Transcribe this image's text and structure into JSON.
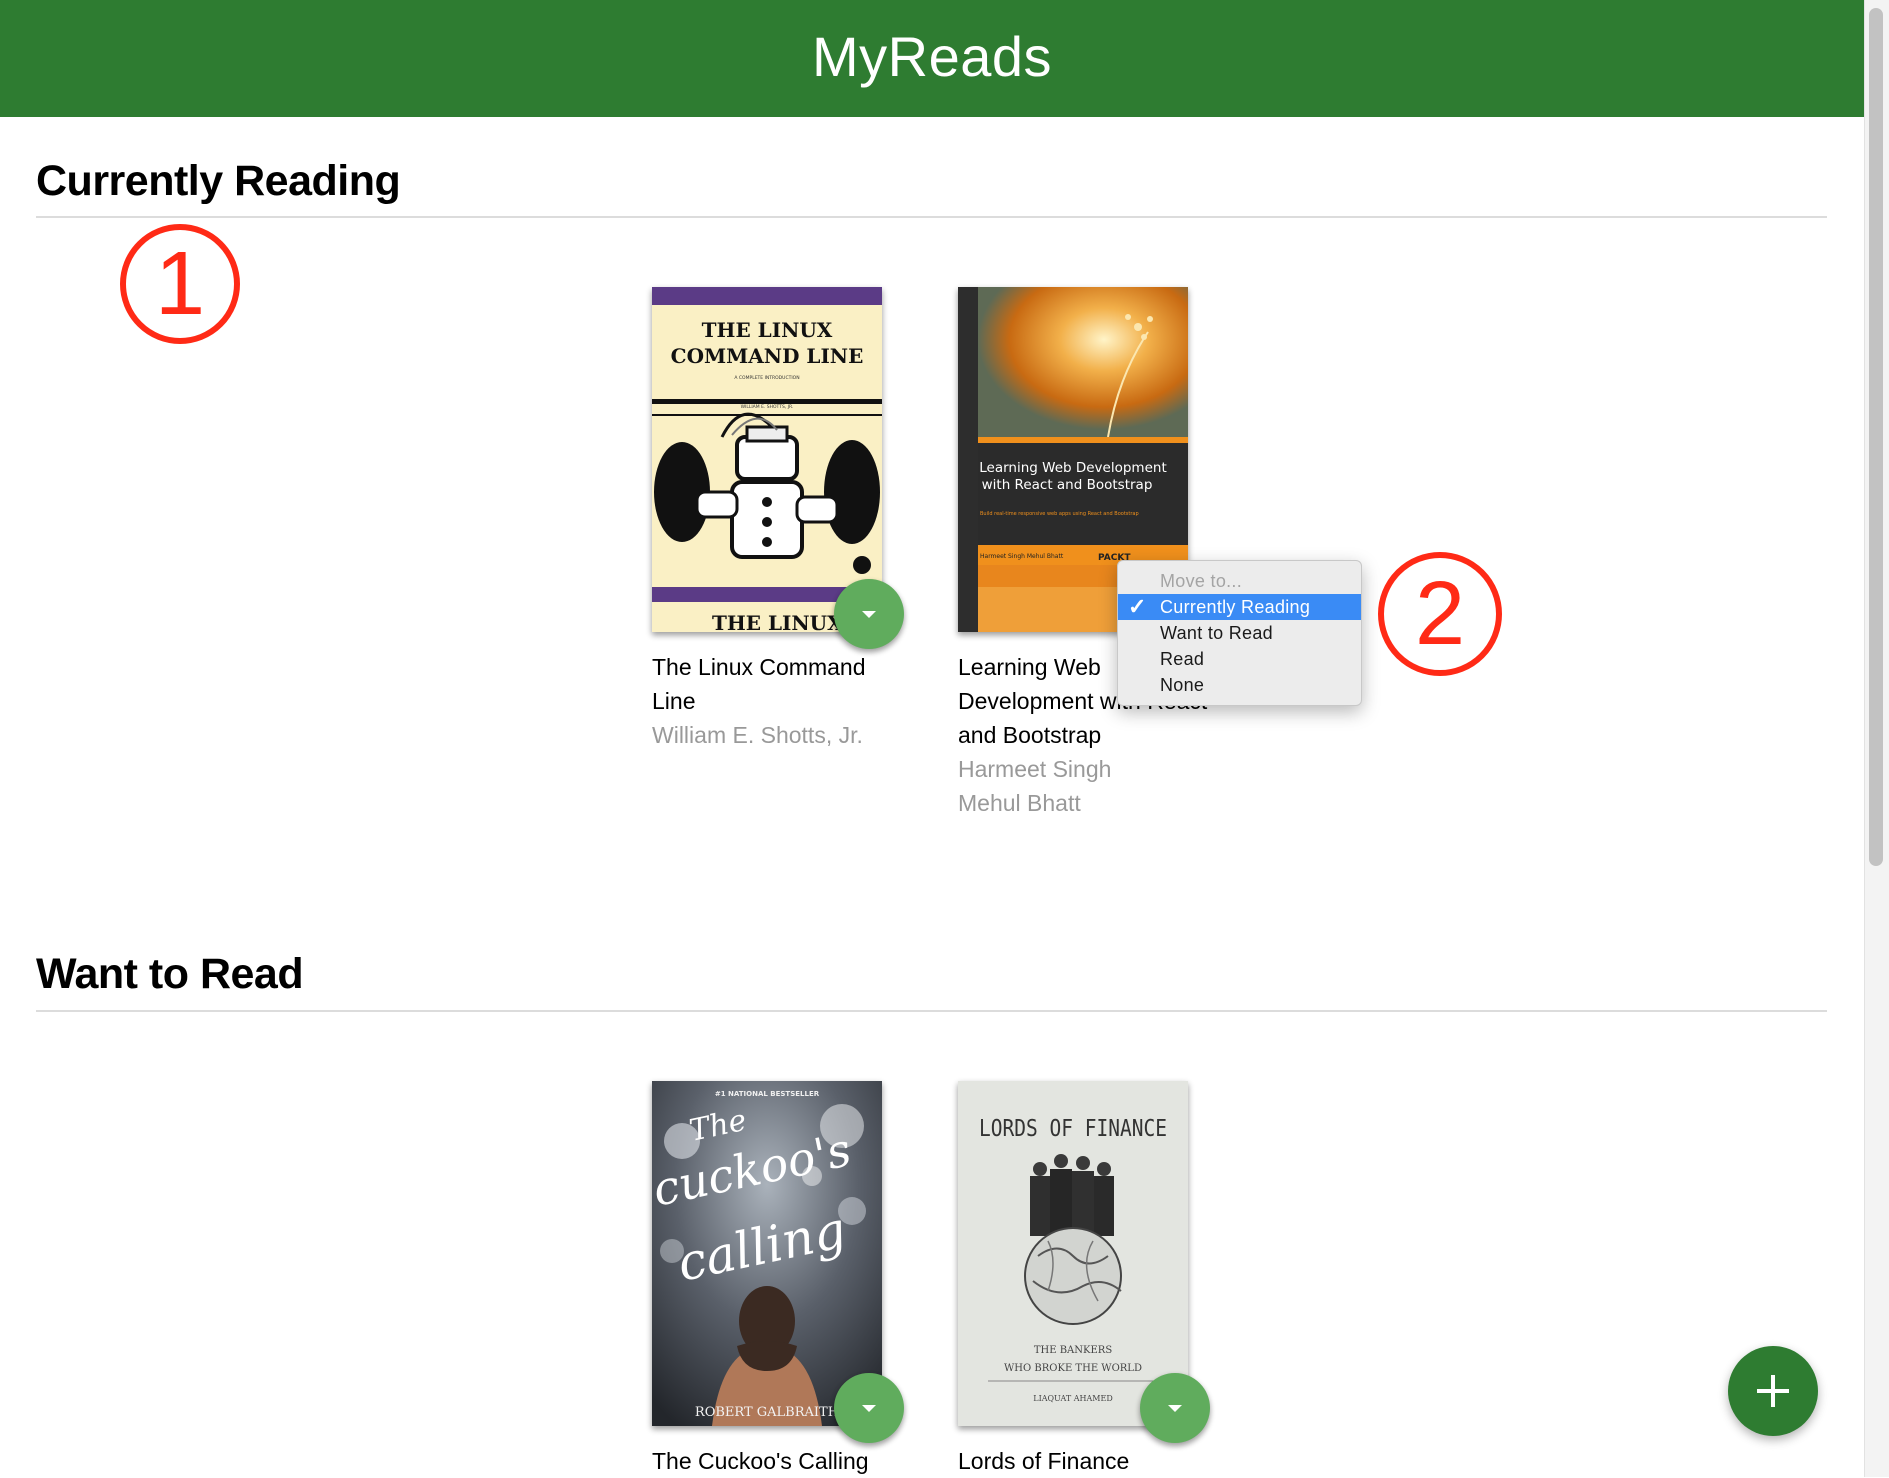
{
  "header": {
    "title": "MyReads"
  },
  "annotations": {
    "first": "1",
    "second": "2"
  },
  "shelves": [
    {
      "title": "Currently Reading",
      "books": [
        {
          "title": "The Linux Command Line",
          "authors": [
            "William E. Shotts, Jr."
          ],
          "cover_text": {
            "line1": "THE LINUX",
            "line2": "COMMAND LINE",
            "subtitle": "A COMPLETE INTRODUCTION",
            "author": "WILLIAM E. SHOTTS, JR."
          },
          "cover_colors": {
            "bg": "#faf0c5",
            "band": "#5b3b86",
            "ink": "#111111"
          }
        },
        {
          "title": "Learning Web Development with React and Bootstrap",
          "title_line1": "Learning Web",
          "title_line2": "Development with React",
          "title_line3": "and Bootstrap",
          "authors": [
            "Harmeet Singh",
            "Mehul Bhatt"
          ],
          "cover_text": {
            "line1": "Learning Web Development",
            "line2": "with React and Bootstrap",
            "tagline": "Build real-time responsive web apps using React and Bootstrap",
            "authors": "Harmeet Singh  Mehul Bhatt",
            "publisher": "PACKT"
          },
          "cover_colors": {
            "top": "#e98a1d",
            "band": "#2d2d2d",
            "accent": "#f0901c"
          }
        }
      ]
    },
    {
      "title": "Want to Read",
      "books": [
        {
          "title": "The Cuckoo's Calling",
          "authors": [],
          "cover_text": {
            "badge": "#1 NATIONAL BESTSELLER",
            "author": "ROBERT GALBRAITH"
          },
          "cover_colors": {
            "bg": "#4a4f57",
            "skin": "#b07858"
          }
        },
        {
          "title": "Lords of Finance",
          "authors": [],
          "cover_text": {
            "title": "LORDS OF FINANCE",
            "subtitle1": "THE BANKERS",
            "subtitle2": "WHO BROKE THE WORLD",
            "author": "LIAQUAT AHAMED"
          },
          "cover_colors": {
            "bg": "#e3e5e0",
            "ink": "#333333"
          }
        }
      ]
    }
  ],
  "shelf_menu": {
    "items": [
      {
        "label": "Move to...",
        "disabled": true
      },
      {
        "label": "Currently Reading",
        "selected": true
      },
      {
        "label": "Want to Read"
      },
      {
        "label": "Read"
      },
      {
        "label": "None"
      }
    ],
    "check_glyph": "✓"
  },
  "icons": {
    "shelf_changer": "triangle-down-icon",
    "add": "plus-icon"
  },
  "colors": {
    "header_bg": "#2e7c31",
    "changer_bg": "#60ac5d",
    "add_bg": "#2e7c31",
    "annotation": "#ff2a16",
    "menu_selected": "#3a8bf5"
  }
}
